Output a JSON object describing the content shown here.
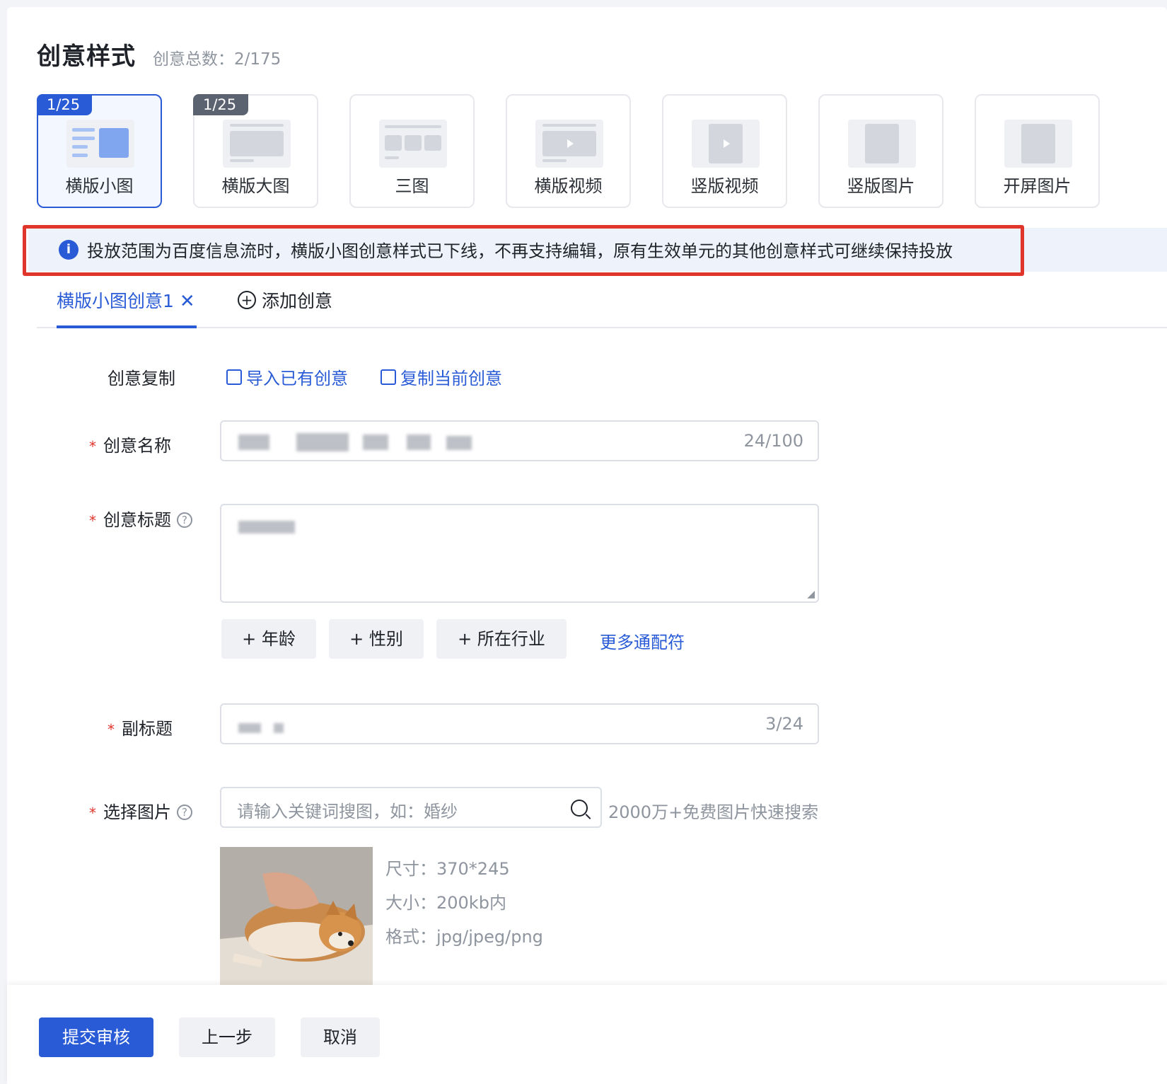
{
  "header": {
    "title": "创意样式",
    "count": "创意总数：2/175"
  },
  "styles": [
    {
      "label": "横版小图",
      "badge": "1/25",
      "active": true
    },
    {
      "label": "横版大图",
      "badge": "1/25"
    },
    {
      "label": "三图"
    },
    {
      "label": "横版视频"
    },
    {
      "label": "竖版视频"
    },
    {
      "label": "竖版图片"
    },
    {
      "label": "开屏图片"
    }
  ],
  "notice": {
    "icon": "info-icon",
    "text": "投放范围为百度信息流时，横版小图创意样式已下线，不再支持编辑，原有生效单元的其他创意样式可继续保持投放"
  },
  "tabs": {
    "active": "横版小图创意1",
    "add": "添加创意"
  },
  "form": {
    "copy_label": "创意复制",
    "import_link": "导入已有创意",
    "copy_link": "复制当前创意",
    "name_label": "创意名称",
    "name_counter": "24/100",
    "title_label": "创意标题",
    "chips": [
      "+ 年龄",
      "+ 性别",
      "+ 所在行业"
    ],
    "more_wildcards": "更多通配符",
    "subtitle_label": "副标题",
    "subtitle_counter": "3/24",
    "image_label": "选择图片",
    "search_placeholder": "请输入关键词搜图，如：婚纱",
    "search_hint": "2000万+免费图片快速搜索",
    "image_specs": [
      "尺寸：370*245",
      "大小：200kb内",
      "格式：jpg/jpeg/png"
    ]
  },
  "footer": {
    "submit": "提交审核",
    "prev": "上一步",
    "cancel": "取消"
  },
  "colors": {
    "accent": "#2a5bd7",
    "alert": "#e0352b",
    "notice_bg": "#eef2fb"
  }
}
